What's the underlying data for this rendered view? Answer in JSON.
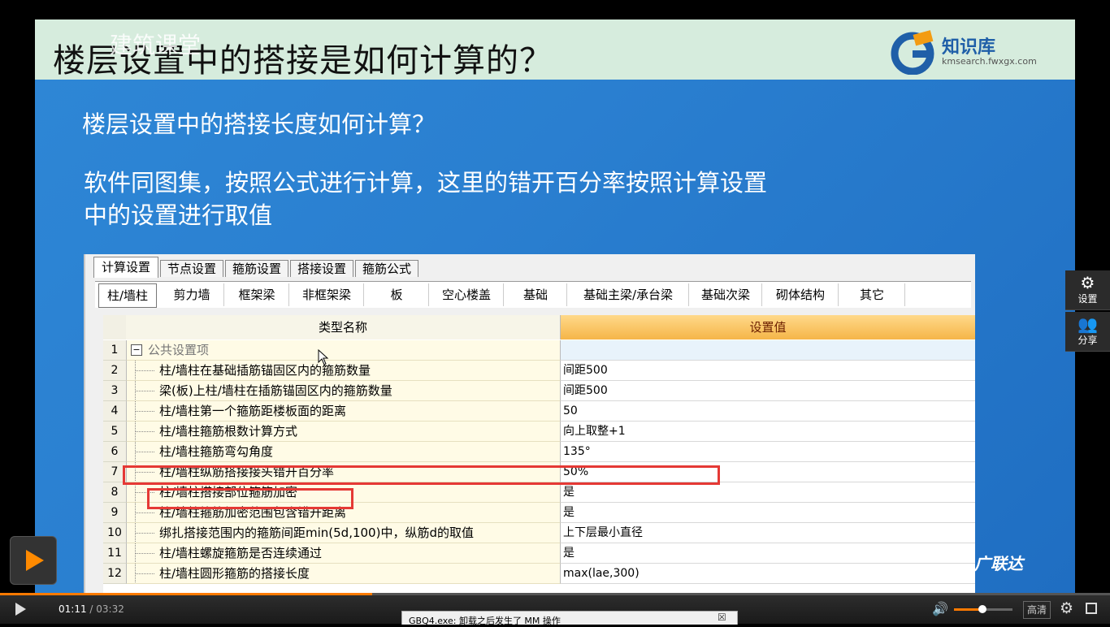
{
  "slide": {
    "title": "楼层设置中的搭接是如何计算的？",
    "watermark": "建筑课堂",
    "logo_name": "知识库",
    "logo_url": "kmsearch.fwxgx.com",
    "question": "楼层设置中的搭接长度如何计算？",
    "answer_line1": "软件同图集，按照公式进行计算，这里的错开百分率按照计算设置",
    "answer_line2": "中的设置进行取值",
    "brand": "广联达"
  },
  "dialog": {
    "main_tabs": [
      "计算设置",
      "节点设置",
      "箍筋设置",
      "搭接设置",
      "箍筋公式"
    ],
    "active_main_tab": 0,
    "sub_tabs": [
      "柱/墙柱",
      "剪力墙",
      "框架梁",
      "非框架梁",
      "板",
      "空心楼盖",
      "基础",
      "基础主梁/承台梁",
      "基础次梁",
      "砌体结构",
      "其它"
    ],
    "active_sub_tab": 0,
    "columns": {
      "name": "类型名称",
      "value": "设置值"
    },
    "rows": [
      {
        "num": "1",
        "name": "公共设置项",
        "value": "",
        "group": true
      },
      {
        "num": "2",
        "name": "柱/墙柱在基础插筋锚固区内的箍筋数量",
        "value": "间距500"
      },
      {
        "num": "3",
        "name": "梁(板)上柱/墙柱在插筋锚固区内的箍筋数量",
        "value": "间距500"
      },
      {
        "num": "4",
        "name": "柱/墙柱第一个箍筋距楼板面的距离",
        "value": "50"
      },
      {
        "num": "5",
        "name": "柱/墙柱箍筋根数计算方式",
        "value": "向上取整+1"
      },
      {
        "num": "6",
        "name": "柱/墙柱箍筋弯勾角度",
        "value": "135°"
      },
      {
        "num": "7",
        "name": "柱/墙柱纵筋搭接接头错开百分率",
        "value": "50%"
      },
      {
        "num": "8",
        "name": "柱/墙柱搭接部位箍筋加密",
        "value": "是"
      },
      {
        "num": "9",
        "name": "柱/墙柱箍筋加密范围包含错开距离",
        "value": "是"
      },
      {
        "num": "10",
        "name": "绑扎搭接范围内的箍筋间距min(5d,100)中，纵筋d的取值",
        "value": "上下层最小直径"
      },
      {
        "num": "11",
        "name": "柱/墙柱螺旋箍筋是否连续通过",
        "value": "是"
      },
      {
        "num": "12",
        "name": "柱/墙柱圆形箍筋的搭接长度",
        "value": "max(lae,300)"
      }
    ]
  },
  "side_panel": {
    "settings": "设置",
    "share": "分享"
  },
  "player": {
    "current_time": "01:11",
    "duration": "/ 03:32",
    "progress": 0.335,
    "volume": 0.48,
    "quality": "高清",
    "accent": "#ff7a00"
  },
  "notification": {
    "message": "GBQ4.exe: 卸载之后发生了 MM 操作",
    "close": "☒"
  }
}
